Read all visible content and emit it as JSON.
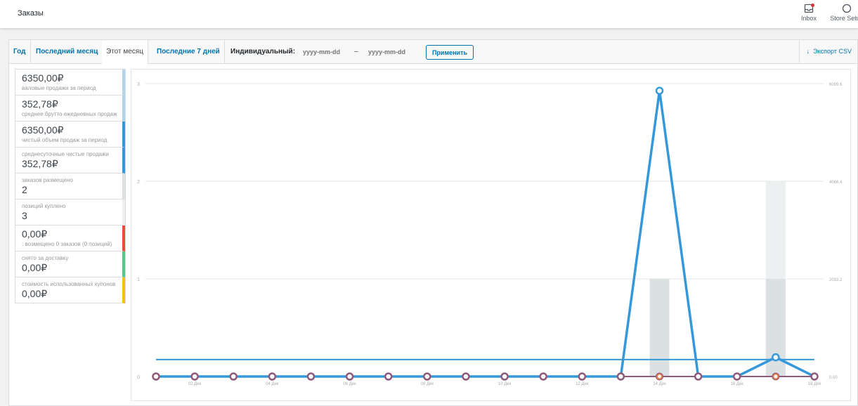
{
  "header": {
    "title": "Заказы",
    "inbox_label": "Inbox",
    "setup_label": "Store Setup"
  },
  "tabs": {
    "items": [
      {
        "label": "Год"
      },
      {
        "label": "Последний месяц"
      },
      {
        "label": "Этот месяц"
      },
      {
        "label": "Последние 7 дней"
      }
    ],
    "active": "Этот месяц",
    "custom_label": "Индивидуальный:",
    "date_from_placeholder": "yyyy-mm-dd",
    "date_to_placeholder": "yyyy-mm-dd",
    "dash": "–",
    "apply_label": "Применить",
    "export_label": "Экспорт CSV"
  },
  "legend": [
    {
      "amount": "6350,00₽",
      "desc": "валовые продажи за период",
      "color": "#b1d4ea"
    },
    {
      "amount": "352,78₽",
      "desc": "среднее брутто ежедневных продаж",
      "color": "#b1d4ea"
    },
    {
      "amount": "6350,00₽",
      "desc": "чистый объем продаж за период",
      "color": "#3498db"
    },
    {
      "desc": "среднесуточные чистые продажи",
      "amount": "352,78₽",
      "color": "#3498db",
      "desc_first": true
    },
    {
      "desc": "заказов размещено",
      "amount": "2",
      "color": "#dbe1e3",
      "desc_first": true
    },
    {
      "desc": "позиций куплено",
      "amount": "3",
      "color": "#ecf0f1",
      "desc_first": true
    },
    {
      "amount": "0,00₽",
      "desc": ": возмещено 0 заказов (0 позиций)",
      "color": "#e74c3c"
    },
    {
      "desc": "снято за доставку",
      "amount": "0,00₽",
      "color": "#5cc488",
      "desc_first": true
    },
    {
      "desc": "стоимость использованных купонов",
      "amount": "0,00₽",
      "color": "#f1c40f",
      "desc_first": true
    }
  ],
  "chart_data": {
    "type": "line",
    "x": [
      "01 Дек",
      "02 Дек",
      "03 Дек",
      "04 Дек",
      "05 Дек",
      "06 Дек",
      "07 Дек",
      "08 Дек",
      "09 Дек",
      "10 Дек",
      "11 Дек",
      "12 Дек",
      "13 Дек",
      "14 Дек",
      "15 Дек",
      "16 Дек",
      "17 Дек",
      "18 Дек"
    ],
    "x_tick_labels": [
      "02 Дек",
      "04 Дек",
      "06 Дек",
      "08 Дек",
      "10 Дек",
      "12 Дек",
      "14 Дек",
      "16 Дек",
      "18 Дек"
    ],
    "left_axis": {
      "ticks": [
        "0",
        "1",
        "2",
        "3"
      ],
      "ylim": [
        0,
        3
      ]
    },
    "right_axis": {
      "ticks": [
        "0.00",
        "2033.2",
        "4066.4",
        "6099.6"
      ],
      "ylim": [
        0,
        6099.6
      ]
    },
    "series": [
      {
        "kind": "bar",
        "axis": "left",
        "color": "#ecf0f1",
        "values": [
          0,
          0,
          0,
          0,
          0,
          0,
          0,
          0,
          0,
          0,
          0,
          0,
          0,
          1,
          0,
          0,
          2,
          0
        ]
      },
      {
        "kind": "bar",
        "axis": "left",
        "color": "#dbe1e3",
        "values": [
          0,
          0,
          0,
          0,
          0,
          0,
          0,
          0,
          0,
          0,
          0,
          0,
          0,
          1,
          0,
          0,
          1,
          0
        ]
      },
      {
        "kind": "hline",
        "axis": "right",
        "color": "#3498db",
        "value": 352.78
      },
      {
        "kind": "line",
        "axis": "right",
        "color": "#3498db",
        "values": [
          0,
          0,
          0,
          0,
          0,
          0,
          0,
          0,
          0,
          0,
          0,
          0,
          0,
          5950,
          0,
          0,
          400,
          0
        ]
      },
      {
        "kind": "line",
        "axis": "right",
        "color": "#e07b53",
        "values": [
          0,
          0,
          0,
          0,
          0,
          0,
          0,
          0,
          0,
          0,
          0,
          0,
          0,
          0,
          0,
          0,
          0,
          0
        ]
      },
      {
        "kind": "line",
        "axis": "right",
        "color": "#8e5a7a",
        "values": [
          0,
          0,
          0,
          0,
          0,
          0,
          0,
          0,
          0,
          0,
          0,
          0,
          0,
          0,
          0,
          0,
          0,
          0
        ]
      }
    ],
    "grid": true
  }
}
